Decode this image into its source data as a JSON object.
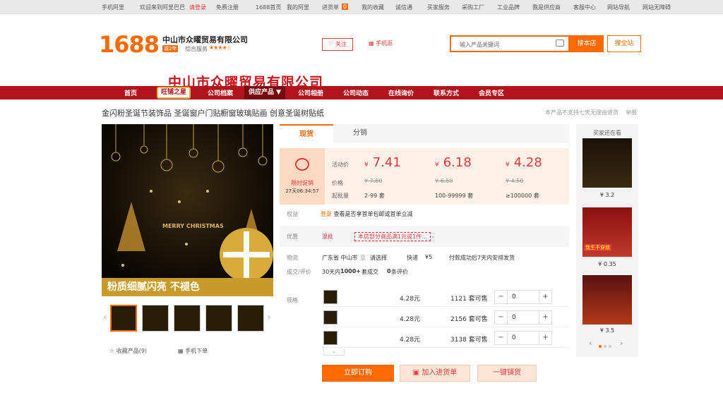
{
  "topbar": {
    "items": [
      "手机阿里",
      "欢迎来到阿里巴巴",
      "请登录",
      "免费注册",
      "1688首页",
      "我的阿里",
      "进货单",
      "我的收藏",
      "诚信通",
      "买家服务",
      "采购工厂",
      "工业品牌",
      "我是供应商",
      "客服中心",
      "网站导航",
      "网站无障碍"
    ],
    "cart_count": "0"
  },
  "header": {
    "logo": "1688",
    "shop_name": "中山市众曜贸易有限公司",
    "year_badge": "诚2年",
    "service_label": "综合服务",
    "stars": "★★★★☆",
    "follow_label": "关注",
    "mobile_label": "手机逛",
    "search_placeholder": "输入产品关键词",
    "search_shop_btn": "搜本店",
    "search_site_btn": "搜全站",
    "banner_title": "中山市众曜贸易有限公司"
  },
  "nav": {
    "items": [
      "首页",
      "旺铺之星",
      "公司档案",
      "供应产品 ▼",
      "公司相册",
      "公司动态",
      "在线询价",
      "联系方式",
      "会员专区"
    ]
  },
  "product": {
    "title": "金闪粉圣诞节装饰品 圣诞窗户门贴橱窗玻璃贴画 创意圣诞树贴纸",
    "no_return_note": "本产品不支持七天无理由退货",
    "report_label": "举报",
    "image_caption": "粉质细腻闪亮  不褪色",
    "image_text": "MERRY CHRISTMAS",
    "favorite_label": "收藏产品(9)",
    "mobile_order_label": "手机下单"
  },
  "tabs": [
    "现货",
    "分销"
  ],
  "price": {
    "promo_title": "限时促销",
    "countdown": "27天06:34:57",
    "label_activity": "活动价",
    "label_price": "价格",
    "label_moq": "起批量",
    "tiers": [
      {
        "activity": "7.41",
        "original": "¥ 7.80",
        "range": "2-99 套"
      },
      {
        "activity": "6.18",
        "original": "¥ 6.50",
        "range": "100-99999 套"
      },
      {
        "activity": "4.28",
        "original": "¥ 4.50",
        "range": "≥100000 套"
      }
    ],
    "currency": "¥"
  },
  "info": {
    "benefit_label": "权益",
    "benefit_tag": "登录",
    "benefit_text": "查看是否享首单包邮或首单立减",
    "mix_label": "优惠",
    "mix_value": "混批",
    "mix_tag": "本店部分商品满1元或1件...",
    "logistics_label": "物流",
    "from": "广东省 中山市",
    "to_sep": "至",
    "to": "请选择",
    "ship_type": "快递",
    "ship_fee": "¥5",
    "ship_note": "付款成功后7天内安排发货",
    "deals_label": "成交/评价",
    "deals_period": "30天内",
    "deals_count": "1000+",
    "deals_unit": "套成交",
    "reviews": "0",
    "reviews_unit": "条评价",
    "spec_label": "规格"
  },
  "specs": [
    {
      "price": "4.28元",
      "stock": "1121 套可售",
      "qty": "0"
    },
    {
      "price": "4.28元",
      "stock": "2156 套可售",
      "qty": "0"
    },
    {
      "price": "4.28元",
      "stock": "3138 套可售",
      "qty": "0"
    }
  ],
  "actions": {
    "order": "立即订购",
    "cart": "加入进货单",
    "one_click": "一键铺货"
  },
  "sidebar": {
    "title": "买家还在看",
    "items": [
      {
        "price": "¥ 3.2"
      },
      {
        "price": "¥ 0.35",
        "label": "我生不穿就"
      },
      {
        "price": "¥ 3.5"
      }
    ]
  }
}
